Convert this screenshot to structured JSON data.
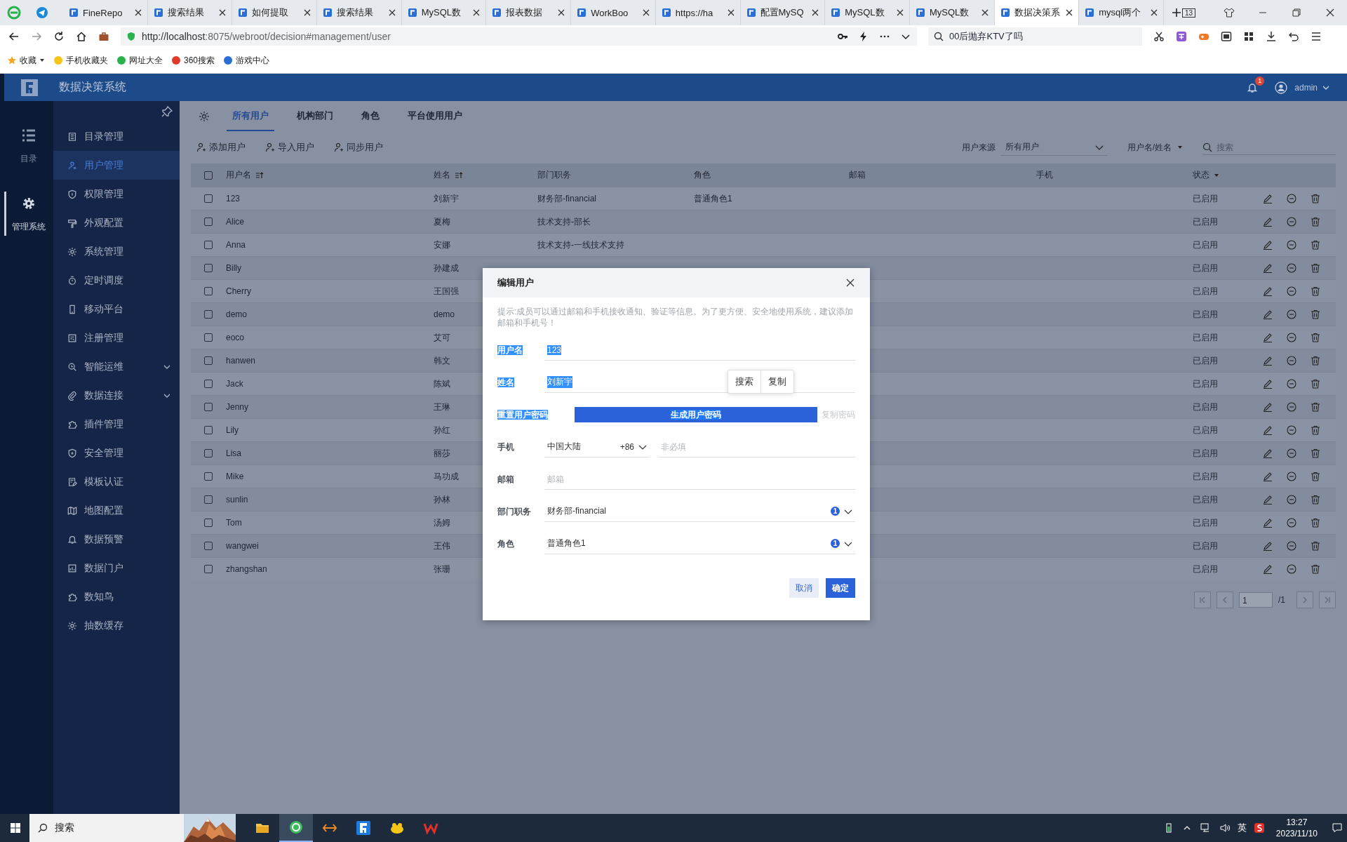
{
  "browser": {
    "tabs": [
      {
        "label": "FineRepo",
        "selected": false
      },
      {
        "label": "搜索结果",
        "selected": false
      },
      {
        "label": "如何提取",
        "selected": false
      },
      {
        "label": "搜索结果",
        "selected": false
      },
      {
        "label": "MySQL数",
        "selected": false
      },
      {
        "label": "报表数据",
        "selected": false
      },
      {
        "label": "WorkBoo",
        "selected": false
      },
      {
        "label": "https://ha",
        "selected": false
      },
      {
        "label": "配置MySQ",
        "selected": false
      },
      {
        "label": "MySQL数",
        "selected": false
      },
      {
        "label": "MySQL数",
        "selected": false
      },
      {
        "label": "数据决策系",
        "selected": true
      },
      {
        "label": "mysql两个",
        "selected": false
      }
    ],
    "tab_count": "13",
    "url_host": "http://localhost",
    "url_rest": ":8075/webroot/decision#management/user",
    "search": "00后抛弃KTV了吗",
    "bookmarks": [
      {
        "label": "收藏",
        "has_menu": true
      },
      {
        "label": "手机收藏夹",
        "has_menu": false
      },
      {
        "label": "网址大全",
        "has_menu": false
      },
      {
        "label": "360搜索",
        "has_menu": false
      },
      {
        "label": "游戏中心",
        "has_menu": false
      }
    ]
  },
  "app": {
    "title": "数据决策系统",
    "notifications": "1",
    "user": "admin",
    "rail": [
      {
        "label": "目录",
        "selected": false
      },
      {
        "label": "管理系统",
        "selected": true
      }
    ],
    "menu": [
      {
        "label": "目录管理",
        "selected": false,
        "expandable": false
      },
      {
        "label": "用户管理",
        "selected": true,
        "expandable": false
      },
      {
        "label": "权限管理",
        "selected": false,
        "expandable": false
      },
      {
        "label": "外观配置",
        "selected": false,
        "expandable": false
      },
      {
        "label": "系统管理",
        "selected": false,
        "expandable": false
      },
      {
        "label": "定时调度",
        "selected": false,
        "expandable": false
      },
      {
        "label": "移动平台",
        "selected": false,
        "expandable": false
      },
      {
        "label": "注册管理",
        "selected": false,
        "expandable": false
      },
      {
        "label": "智能运维",
        "selected": false,
        "expandable": true
      },
      {
        "label": "数据连接",
        "selected": false,
        "expandable": true
      },
      {
        "label": "插件管理",
        "selected": false,
        "expandable": false
      },
      {
        "label": "安全管理",
        "selected": false,
        "expandable": false
      },
      {
        "label": "模板认证",
        "selected": false,
        "expandable": false
      },
      {
        "label": "地图配置",
        "selected": false,
        "expandable": false
      },
      {
        "label": "数据预警",
        "selected": false,
        "expandable": false
      },
      {
        "label": "数据门户",
        "selected": false,
        "expandable": false
      },
      {
        "label": "数知鸟",
        "selected": false,
        "expandable": false
      },
      {
        "label": "抽数缓存",
        "selected": false,
        "expandable": false
      }
    ],
    "tabs": [
      {
        "label": "所有用户",
        "selected": true
      },
      {
        "label": "机构部门",
        "selected": false
      },
      {
        "label": "角色",
        "selected": false
      },
      {
        "label": "平台使用用户",
        "selected": false
      }
    ],
    "toolbar": [
      "添加用户",
      "导入用户",
      "同步用户"
    ],
    "filter": {
      "source_label": "用户来源",
      "source_value": "所有用户",
      "field": "用户名/姓名",
      "search_placeholder": "搜索"
    },
    "table": {
      "select_all_checked": false,
      "columns": [
        {
          "label": "用户名",
          "kind": "sort"
        },
        {
          "label": "姓名",
          "kind": "sort"
        },
        {
          "label": "部门职务",
          "kind": "plain"
        },
        {
          "label": "角色",
          "kind": "plain"
        },
        {
          "label": "邮箱",
          "kind": "plain"
        },
        {
          "label": "手机",
          "kind": "plain"
        },
        {
          "label": "状态",
          "kind": "filter"
        }
      ],
      "rows": [
        {
          "username": "123",
          "name": "刘新宇",
          "department": "财务部-financial",
          "role": "普通角色1",
          "status": "已启用",
          "checked": false
        },
        {
          "username": "Alice",
          "name": "夏梅",
          "department": "技术支持-部长",
          "status": "已启用",
          "checked": false
        },
        {
          "username": "Anna",
          "name": "安娜",
          "department": "技术支持-一线技术支持",
          "status": "已启用",
          "checked": false
        },
        {
          "username": "Billy",
          "name": "孙建成",
          "status": "已启用",
          "checked": false
        },
        {
          "username": "Cherry",
          "name": "王国强",
          "status": "已启用",
          "checked": false
        },
        {
          "username": "demo",
          "name": "demo",
          "status": "已启用",
          "checked": false
        },
        {
          "username": "eoco",
          "name": "艾可",
          "status": "已启用",
          "checked": false
        },
        {
          "username": "hanwen",
          "name": "韩文",
          "status": "已启用",
          "checked": false
        },
        {
          "username": "Jack",
          "name": "陈斌",
          "status": "已启用",
          "checked": false
        },
        {
          "username": "Jenny",
          "name": "王琳",
          "status": "已启用",
          "checked": false
        },
        {
          "username": "Lily",
          "name": "孙红",
          "status": "已启用",
          "checked": false
        },
        {
          "username": "Lisa",
          "name": "丽莎",
          "status": "已启用",
          "checked": false
        },
        {
          "username": "Mike",
          "name": "马功成",
          "status": "已启用",
          "checked": false
        },
        {
          "username": "sunlin",
          "name": "孙林",
          "status": "已启用",
          "checked": false
        },
        {
          "username": "Tom",
          "name": "汤姆",
          "status": "已启用",
          "checked": false
        },
        {
          "username": "wangwei",
          "name": "王伟",
          "status": "已启用",
          "checked": false
        },
        {
          "username": "zhangshan",
          "name": "张珊",
          "status": "已启用",
          "checked": false
        }
      ]
    },
    "pagination": {
      "page": "1",
      "total": "/1"
    }
  },
  "modal": {
    "title": "编辑用户",
    "hint": "提示:成员可以通过邮箱和手机接收通知、验证等信息。为了更方便、安全地使用系统，建议添加邮箱和手机号！",
    "fields": [
      {
        "kind": "text",
        "label": "用户名",
        "value": "123",
        "highlighted": true
      },
      {
        "kind": "text",
        "label": "姓名",
        "value": "刘新宇",
        "highlighted": true
      },
      {
        "kind": "password",
        "label": "重置用户密码",
        "button": "生成用户密码",
        "link": "复制密码",
        "link_disabled": true,
        "highlighted": true
      },
      {
        "kind": "phone",
        "label": "手机",
        "region": "中国大陆",
        "code": "+86",
        "placeholder": "非必填",
        "highlighted": false
      },
      {
        "kind": "text",
        "label": "邮箱",
        "placeholder": "邮箱",
        "highlighted": false
      },
      {
        "kind": "select",
        "label": "部门职务",
        "value": "财务部-financial",
        "count": "1",
        "highlighted": false
      },
      {
        "kind": "select",
        "label": "角色",
        "value": "普通角色1",
        "count": "1",
        "highlighted": false
      }
    ],
    "context_menu": [
      "搜索",
      "复制"
    ],
    "buttons": [
      {
        "label": "取消",
        "kind": "secondary"
      },
      {
        "label": "确定",
        "kind": "primary"
      }
    ]
  },
  "taskbar": {
    "search": "搜索",
    "ime": "英",
    "time": "13:27",
    "date": "2023/11/10"
  }
}
